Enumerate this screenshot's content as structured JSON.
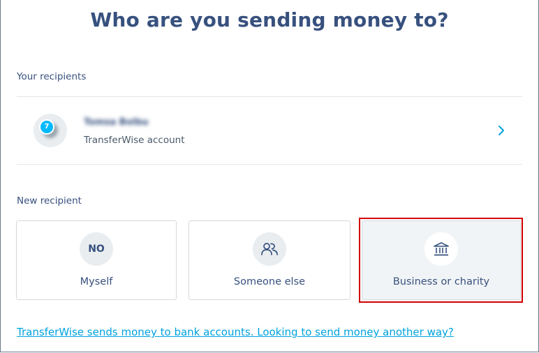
{
  "page": {
    "title": "Who are you sending money to?"
  },
  "your_recipients": {
    "heading": "Your recipients",
    "items": [
      {
        "name": "Tomsa Bolbu",
        "subtitle": "TransferWise account",
        "badge": "7"
      }
    ]
  },
  "new_recipient": {
    "heading": "New recipient",
    "options": [
      {
        "label": "Myself",
        "icon_text": "NO",
        "icon": "initials-avatar"
      },
      {
        "label": "Someone else",
        "icon": "people-icon"
      },
      {
        "label": "Business or charity",
        "icon": "bank-icon",
        "selected": true
      }
    ]
  },
  "footer": {
    "link_text": "TransferWise sends money to bank accounts. Looking to send money another way?"
  },
  "colors": {
    "primary_text": "#37517e",
    "link": "#00a2dd",
    "badge": "#00b9ff",
    "highlight_border": "#d00000"
  }
}
